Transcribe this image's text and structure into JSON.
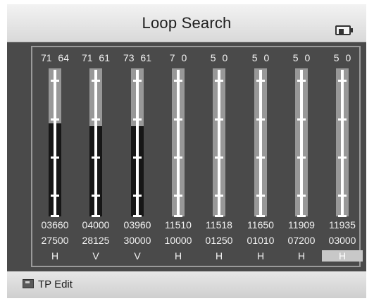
{
  "header": {
    "title": "Loop Search",
    "battery_icon": "battery-icon"
  },
  "channels": [
    {
      "top": "71 64",
      "level": 0.63,
      "freq": "03660",
      "sym": "27500",
      "pol": "H"
    },
    {
      "top": "71 61",
      "level": 0.61,
      "freq": "04000",
      "sym": "28125",
      "pol": "V"
    },
    {
      "top": "73 61",
      "level": 0.61,
      "freq": "03960",
      "sym": "30000",
      "pol": "V"
    },
    {
      "top": "7 0",
      "level": 0,
      "freq": "11510",
      "sym": "10000",
      "pol": "H"
    },
    {
      "top": "5 0",
      "level": 0,
      "freq": "11518",
      "sym": "01250",
      "pol": "H"
    },
    {
      "top": "5 0",
      "level": 0,
      "freq": "11650",
      "sym": "01010",
      "pol": "H"
    },
    {
      "top": "5 0",
      "level": 0,
      "freq": "11909",
      "sym": "07200",
      "pol": "H"
    },
    {
      "top": "5 0",
      "level": 0,
      "freq": "11935",
      "sym": "03000",
      "pol": "H"
    }
  ],
  "selected_channel": 7,
  "footer": {
    "ok_button_icon": "ok-button-icon",
    "label": "TP Edit"
  },
  "colors": {
    "background": "#4a4a4a",
    "bar_track": "#989898",
    "bar_fill": "#161616",
    "scale": "#ffffff"
  }
}
